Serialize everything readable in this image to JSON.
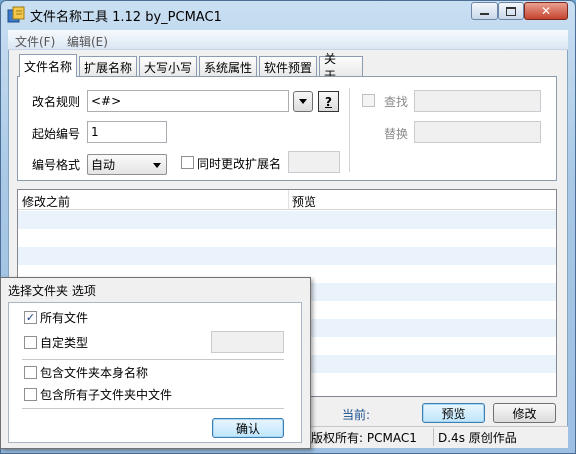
{
  "window": {
    "title": "文件名称工具 1.12  by_PCMAC1"
  },
  "menu": [
    "文件(F)",
    "编辑(E)"
  ],
  "tabs": [
    "文件名称",
    "扩展名称",
    "大写小写",
    "系统属性",
    "软件预置",
    "关于..."
  ],
  "form": {
    "rename_rule_label": "改名规则",
    "rename_rule_value": "<#>",
    "help_button": "?",
    "start_number_label": "起始编号",
    "start_number_value": "1",
    "number_format_label": "编号格式",
    "number_format_value": "自动",
    "change_ext_label": "同时更改扩展名",
    "find_label": "查找",
    "replace_label": "替换"
  },
  "list": {
    "columns": [
      "修改之前",
      "预览"
    ]
  },
  "bottom": {
    "current_label": "当前:",
    "preview_button": "预览",
    "modify_button": "修改",
    "copyright": "版权所有: PCMAC1",
    "author": "D.4s 原创作品"
  },
  "popup": {
    "title": "选择文件夹 选项",
    "all_files": "所有文件",
    "custom_type": "自定类型",
    "include_folder_name": "包含文件夹本身名称",
    "include_subfolder_files": "包含所有子文件夹中文件",
    "confirm_button": "确认"
  },
  "colors": {
    "accent": "#3c7fb1",
    "highlight_text": "#1a4f8b"
  }
}
